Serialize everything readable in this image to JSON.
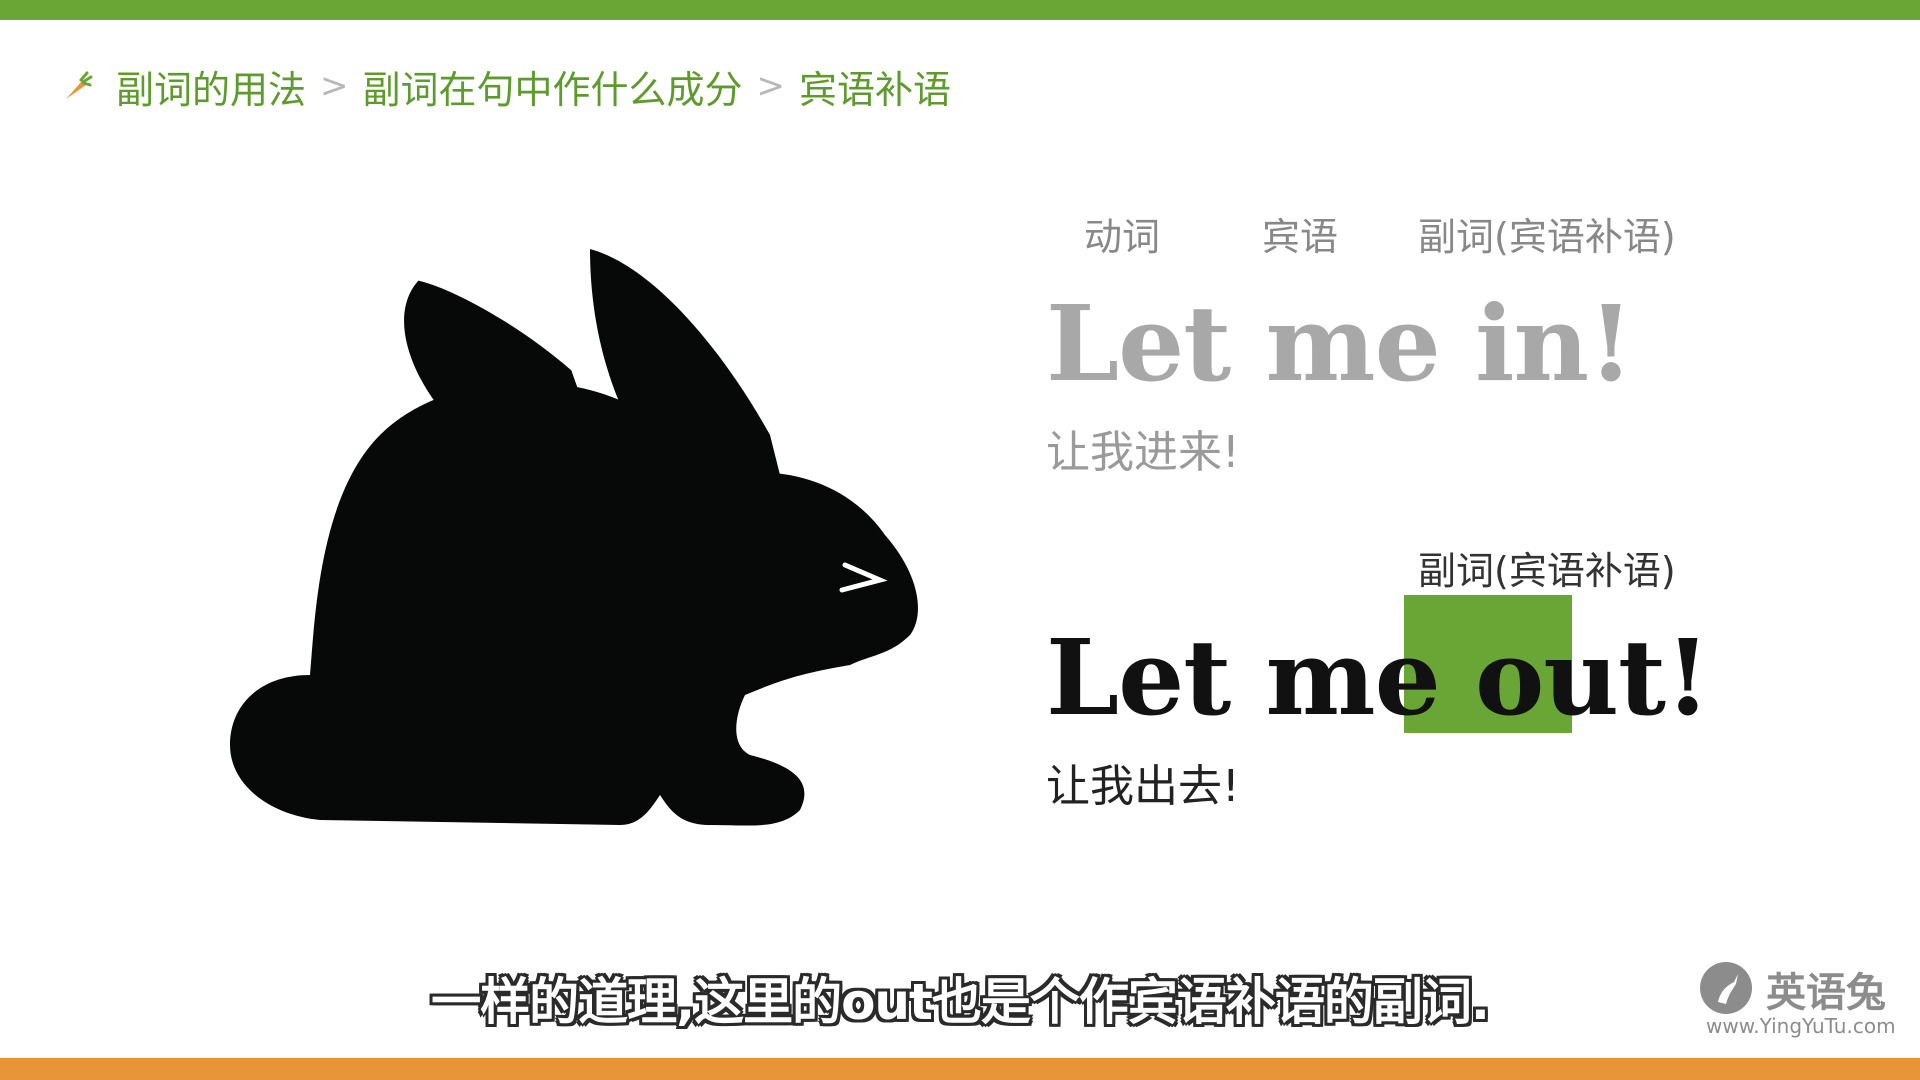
{
  "colors": {
    "accent_green": "#6aa636",
    "accent_orange": "#e8953a",
    "breadcrumb_text": "#5f9a2f"
  },
  "breadcrumb": {
    "icon": "carrot-icon",
    "items": [
      "副词的用法",
      "副词在句中作什么成分",
      "宾语补语"
    ],
    "separator": ">"
  },
  "illustration": {
    "icon": "rabbit-silhouette-icon"
  },
  "example1": {
    "labels": {
      "verb": "动词",
      "object": "宾语",
      "adverb": "副词(宾语补语)"
    },
    "sentence": "Let me in!",
    "translation": "让我进来!"
  },
  "example2": {
    "label_adverb": "副词(宾语补语)",
    "sentence_prefix": "Let me ",
    "highlighted_word": "out",
    "sentence_suffix": "!",
    "translation": "让我出去!"
  },
  "subtitle": "一样的道理,这里的out也是个作宾语补语的副词.",
  "brand": {
    "icon": "rabbit-logo-icon",
    "name": "英语兔",
    "url": "www.YingYuTu.com"
  }
}
